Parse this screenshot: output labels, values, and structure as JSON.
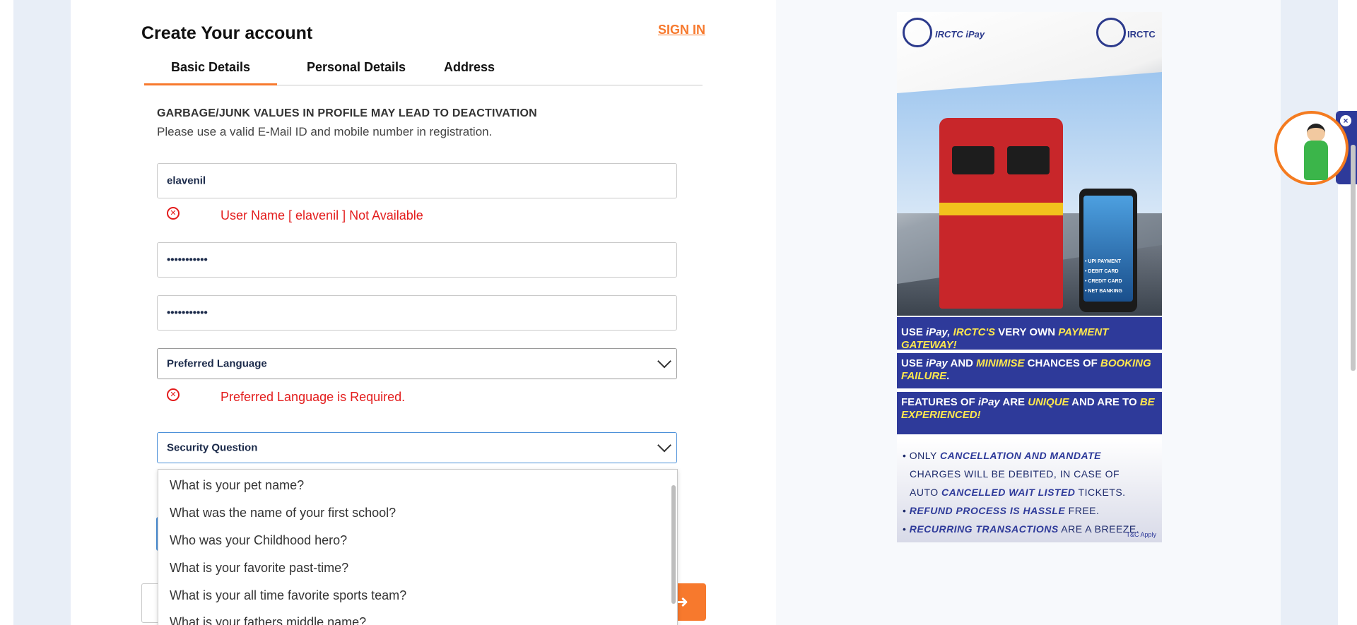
{
  "header": {
    "title": "Create Your account",
    "signin_label": "SIGN IN"
  },
  "tabs": [
    {
      "label": "Basic Details",
      "active": true
    },
    {
      "label": "Personal Details",
      "active": false
    },
    {
      "label": "Address",
      "active": false
    }
  ],
  "notice": {
    "title": "GARBAGE/JUNK VALUES IN PROFILE MAY LEAD TO DEACTIVATION",
    "text": "Please use a valid E-Mail ID and mobile number in registration."
  },
  "form": {
    "username": "elavenil",
    "username_error": "User Name [ elavenil ] Not Available",
    "password": "•••••••••••",
    "confirm_password": "•••••••••••",
    "language_placeholder": "Preferred Language",
    "language_error": "Preferred Language is Required.",
    "security_question_placeholder": "Security Question"
  },
  "security_questions": [
    "What is your pet name?",
    "What was the name of your first school?",
    "Who was your Childhood hero?",
    "What is your favorite past-time?",
    "What is your all time favorite sports team?",
    "What is your fathers middle name?"
  ],
  "ad": {
    "brand_left": "IRCTC iPay",
    "brand_right": "IRCTC",
    "phone_items": [
      "• UPI PAYMENT",
      "• DEBIT CARD",
      "• CREDIT CARD",
      "• NET BANKING"
    ],
    "band1": {
      "a": "USE ",
      "b": "iPay, ",
      "c": "IRCTC'S",
      "d": " VERY OWN ",
      "e": "PAYMENT GATEWAY!"
    },
    "band2": {
      "a": "USE ",
      "b": "iPay",
      "c": " AND ",
      "d": "MINIMISE",
      "e": " CHANCES OF ",
      "f": "BOOKING FAILURE",
      "g": "."
    },
    "band3": {
      "a": "FEATURES OF ",
      "b": "iPay",
      "c": " ARE ",
      "d": "UNIQUE",
      "e": " AND ARE TO ",
      "f": "BE EXPERIENCED!"
    },
    "list": [
      {
        "a": "• ONLY ",
        "b": "CANCELLATION AND MANDATE"
      },
      {
        "a": "  CHARGES WILL BE DEBITED, IN CASE OF",
        "b": ""
      },
      {
        "a": "  AUTO ",
        "b": "CANCELLED WAIT LISTED",
        "c": " TICKETS."
      },
      {
        "a": "• ",
        "b": "REFUND PROCESS IS HASSLE",
        "c": " FREE."
      },
      {
        "a": "• ",
        "b": "RECURRING TRANSACTIONS",
        "c": " ARE A BREEZE."
      }
    ],
    "tc": "T&C Apply"
  },
  "colors": {
    "accent": "#f7792d",
    "error": "#e31c1c",
    "ad_band": "#2e3a9a",
    "focus": "#4a8fd8"
  },
  "icons": {
    "error": "error-circle-icon",
    "chevron": "chevron-down-icon",
    "next": "arrow-right-icon",
    "close": "close-icon"
  }
}
